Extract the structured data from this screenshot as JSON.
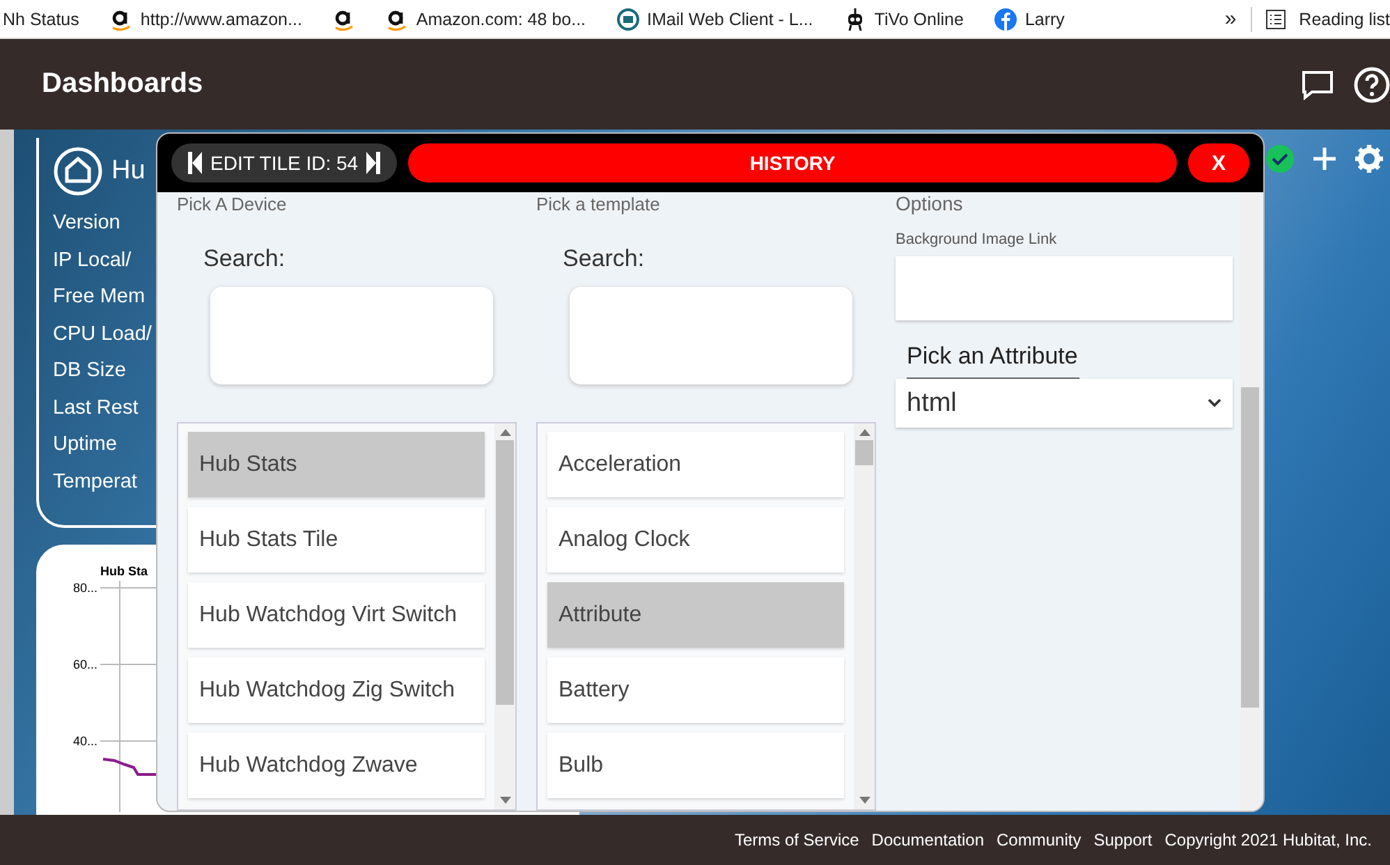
{
  "bookmarks": [
    {
      "kind": "none",
      "label": "Nh Status"
    },
    {
      "kind": "amazon",
      "label": "http://www.amazon..."
    },
    {
      "kind": "amazon"
    },
    {
      "kind": "amazon",
      "label": "Amazon.com: 48 bo..."
    },
    {
      "kind": "imail",
      "label": "IMail Web Client - L..."
    },
    {
      "kind": "tivo",
      "label": "TiVo Online"
    },
    {
      "kind": "facebook",
      "label": "Larry"
    }
  ],
  "bookmarks_more": "»",
  "reading_list": "Reading list",
  "header": {
    "title": "Dashboards"
  },
  "hub_tile": {
    "title": "Hu",
    "labels": [
      "Version",
      "IP Local/",
      "Free Mem",
      "CPU Load/",
      "DB Size",
      "Last Rest",
      "Uptime",
      "Temperat"
    ]
  },
  "chart_tile": {
    "title": "Hub Sta",
    "y_labels": [
      "80...",
      "60...",
      "40..."
    ]
  },
  "modal": {
    "tile_id": "EDIT TILE ID: 54",
    "history": "HISTORY",
    "close": "X",
    "device_picker": {
      "label": "Pick A Device",
      "search_label": "Search:",
      "items": [
        {
          "label": "Hub Stats",
          "selected": true
        },
        {
          "label": "Hub Stats Tile",
          "selected": false
        },
        {
          "label": "Hub Watchdog Virt Switch",
          "selected": false
        },
        {
          "label": "Hub Watchdog Zig Switch",
          "selected": false
        },
        {
          "label": "Hub Watchdog Zwave",
          "selected": false
        }
      ]
    },
    "template_picker": {
      "label": "Pick a template",
      "search_label": "Search:",
      "items": [
        {
          "label": "Acceleration",
          "selected": false
        },
        {
          "label": "Analog Clock",
          "selected": false
        },
        {
          "label": "Attribute",
          "selected": true
        },
        {
          "label": "Battery",
          "selected": false
        },
        {
          "label": "Bulb",
          "selected": false
        }
      ]
    },
    "options": {
      "label": "Options",
      "background_link_label": "Background Image Link",
      "attribute_label": "Pick an Attribute",
      "attribute_value": "html"
    }
  },
  "footer": {
    "links": [
      "Terms of Service",
      "Documentation",
      "Community",
      "Support"
    ],
    "copyright": "Copyright 2021 Hubitat, Inc."
  }
}
